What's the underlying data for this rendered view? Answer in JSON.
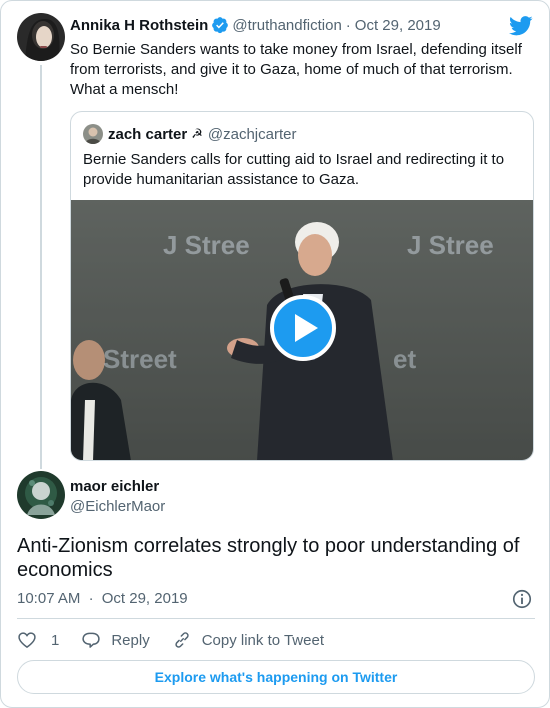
{
  "colors": {
    "accent": "#1d9bf0",
    "text": "#0f1419",
    "muted": "#536471",
    "border": "#cfd9de",
    "play_button": "#1d9bf0"
  },
  "parent_tweet": {
    "name": "Annika H Rothstein",
    "handle": "@truthandfiction",
    "separator": "·",
    "date": "Oct 29, 2019",
    "text": "So Bernie Sanders wants to take money from Israel, defending itself from terrorists, and give it to Gaza, home of much of that terrorism. What a mensch!",
    "verified_icon": "verified-badge-icon",
    "platform_icon": "twitter-bird-icon"
  },
  "quoted_tweet": {
    "name": "zach carter",
    "name_emoji": "☭",
    "handle": "@zachjcarter",
    "text": "Bernie Sanders calls for cutting aid to Israel and redirecting it to provide humanitarian assistance to Gaza.",
    "media": {
      "type": "video",
      "play_icon": "play-icon",
      "backdrop_sign_1": "J Stree",
      "backdrop_sign_2": "J Stree",
      "backdrop_sign_3": "Street",
      "backdrop_sign_4": "et"
    }
  },
  "reply_tweet": {
    "name": "maor eichler",
    "handle": "@EichlerMaor",
    "text": "Anti-Zionism correlates strongly to poor understanding of economics",
    "time": "10:07 AM",
    "separator": "·",
    "date": "Oct 29, 2019",
    "info_icon": "info-icon"
  },
  "actions": {
    "like_count": "1",
    "reply_label": "Reply",
    "copy_link_label": "Copy link to Tweet"
  },
  "explore_button": {
    "label": "Explore what's happening on Twitter"
  }
}
